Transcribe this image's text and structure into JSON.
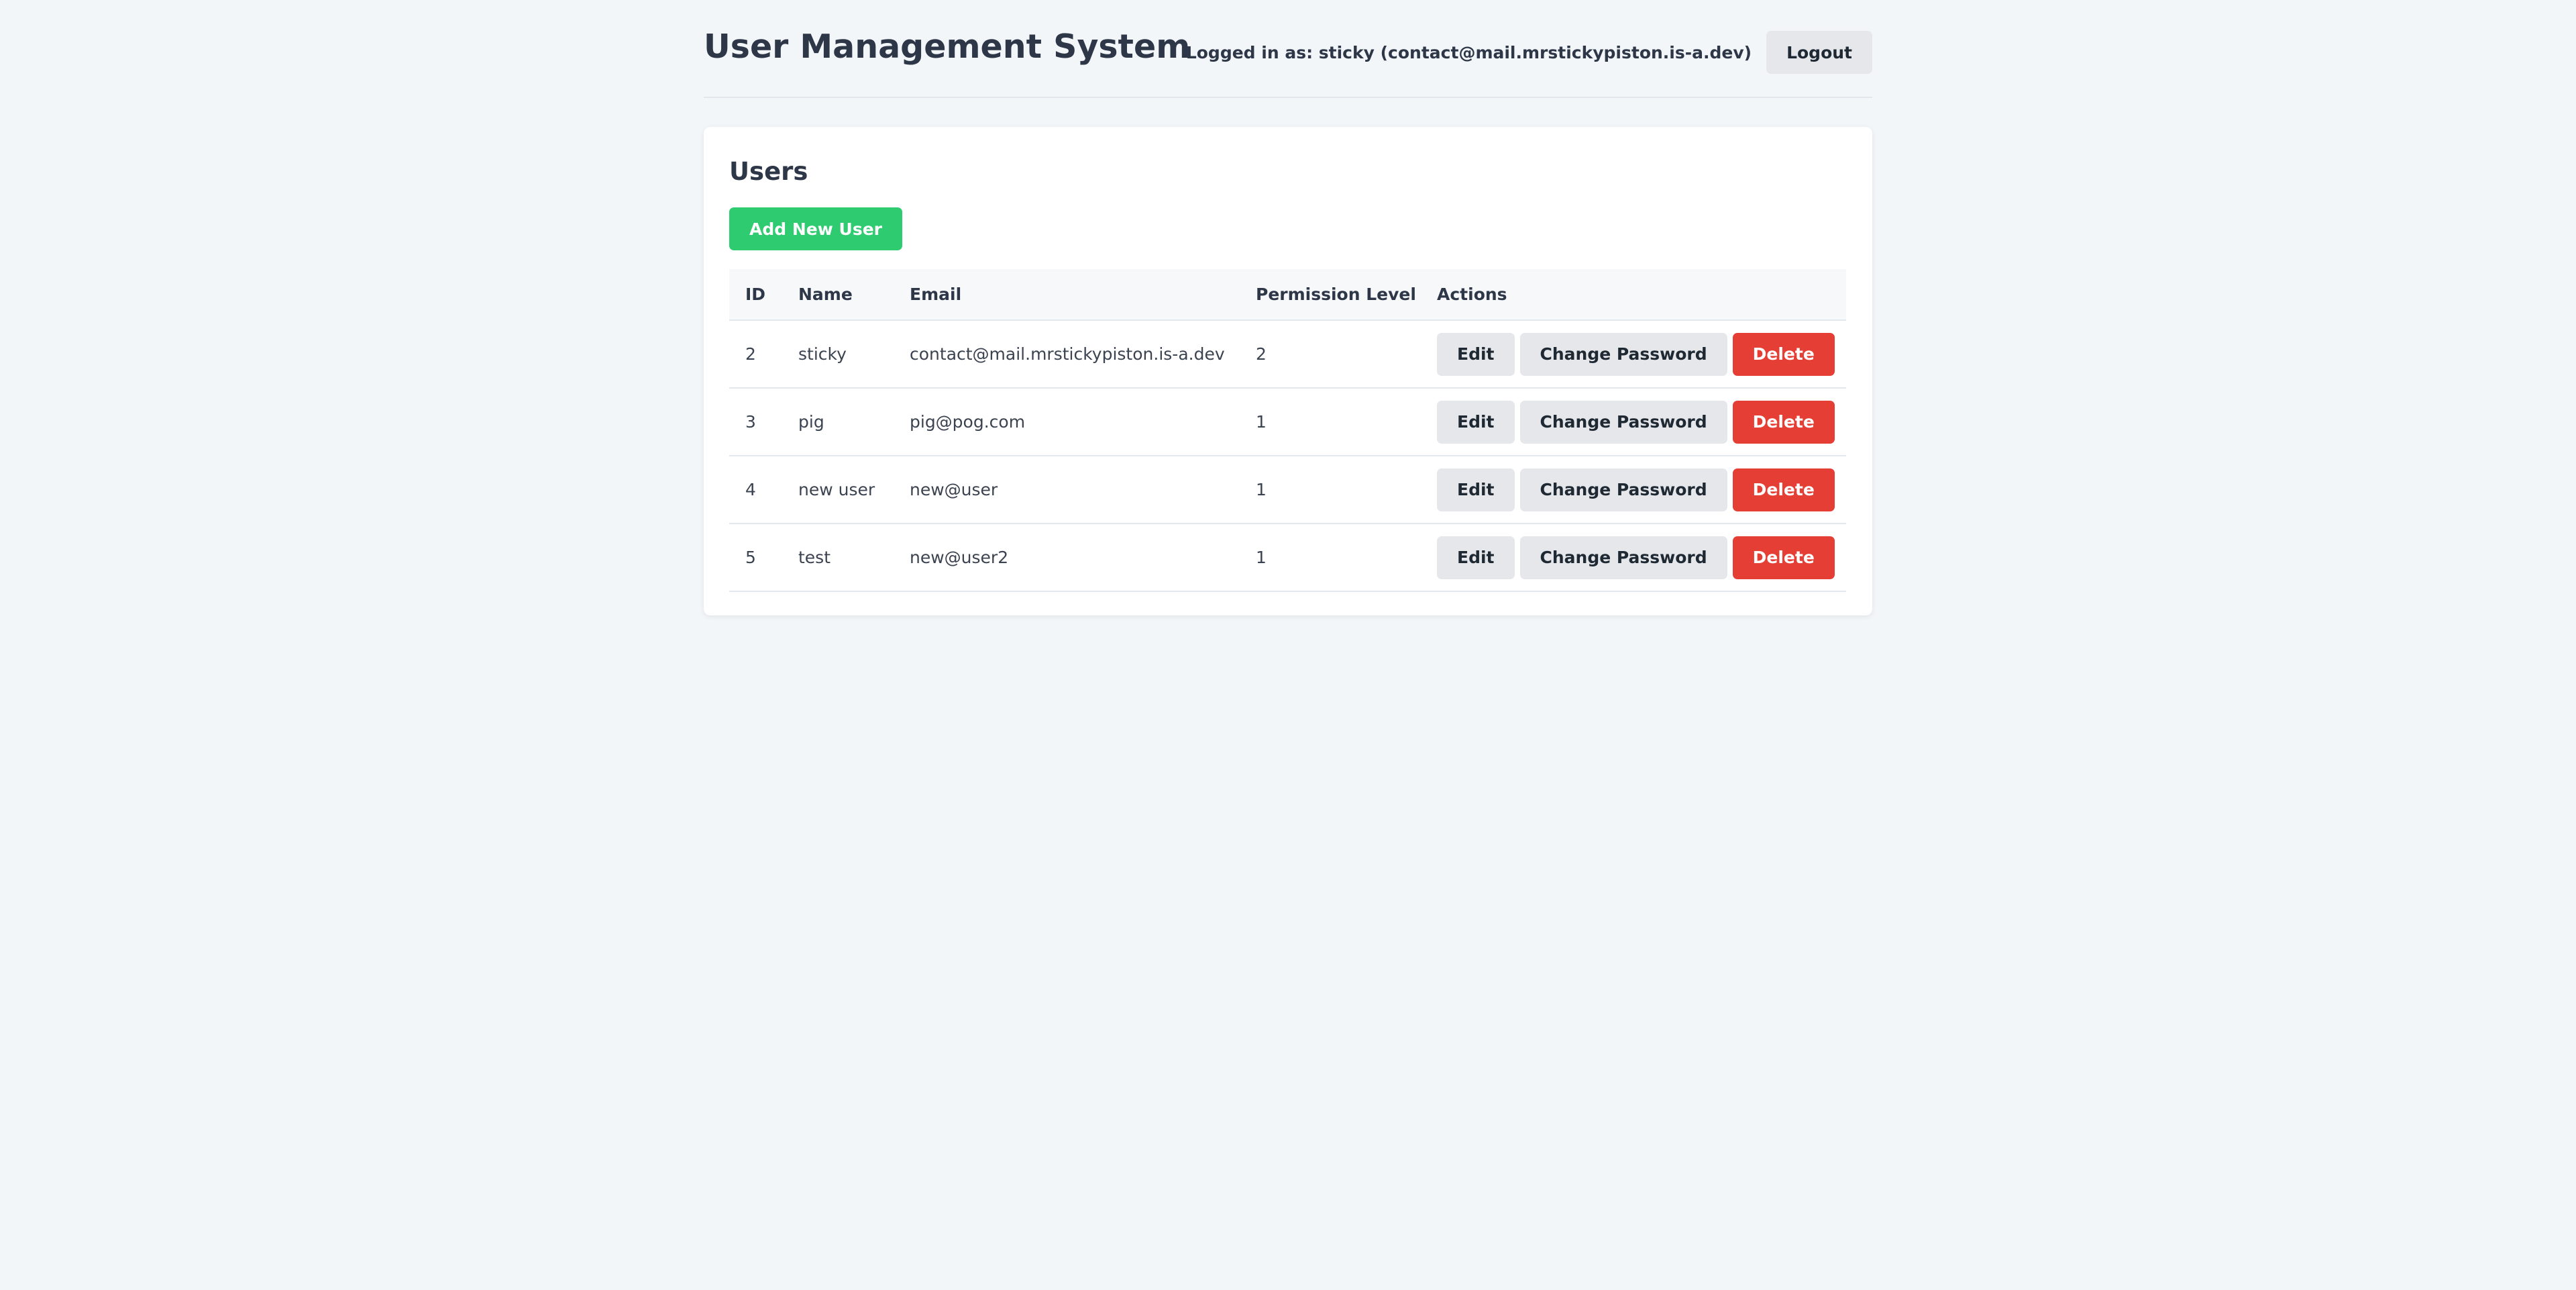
{
  "header": {
    "title": "User Management System",
    "logged_in_text": "Logged in as: sticky (contact@mail.mrstickypiston.is-a.dev)",
    "logout_label": "Logout"
  },
  "users_section": {
    "title": "Users",
    "add_button_label": "Add New User",
    "columns": [
      "ID",
      "Name",
      "Email",
      "Permission Level",
      "Actions"
    ],
    "rows": [
      {
        "id": "2",
        "name": "sticky",
        "email": "contact@mail.mrstickypiston.is-a.dev",
        "permission": "2"
      },
      {
        "id": "3",
        "name": "pig",
        "email": "pig@pog.com",
        "permission": "1"
      },
      {
        "id": "4",
        "name": "new user",
        "email": "new@user",
        "permission": "1"
      },
      {
        "id": "5",
        "name": "test",
        "email": "new@user2",
        "permission": "1"
      }
    ],
    "actions": {
      "edit_label": "Edit",
      "change_password_label": "Change Password",
      "delete_label": "Delete"
    }
  },
  "colors": {
    "background": "#f3f6f9",
    "add_button": "#2fcb70",
    "delete_button": "#e53e34",
    "neutral_button": "#e5e7ea"
  }
}
